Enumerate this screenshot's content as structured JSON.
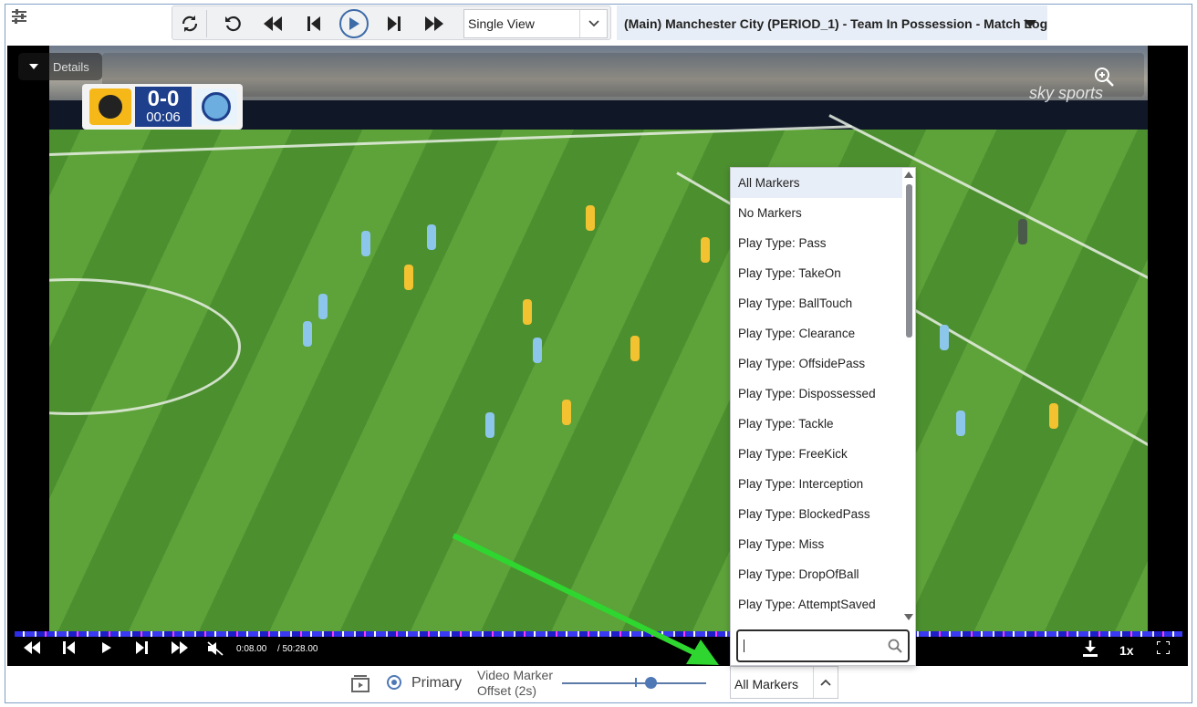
{
  "toolbar": {
    "buttons": [
      "sync",
      "replay",
      "rewind",
      "skip-back",
      "play",
      "skip-forward",
      "fast-forward"
    ],
    "view_select": {
      "value": "Single View"
    },
    "match_log_title": "(Main) Manchester City (PERIOD_1) - Team In Possession - Match Log"
  },
  "video": {
    "details_label": "Details",
    "scoreboard": {
      "score": "0-0",
      "clock": "00:06"
    },
    "broadcaster": "sky sports",
    "controls": {
      "current_time": "0:08.00",
      "total_time": "/ 50:28.00",
      "speed": "1x"
    }
  },
  "bottom": {
    "primary_label": "Primary",
    "offset_label_line1": "Video Marker",
    "offset_label_line2": "Offset (2s)",
    "marker_select_value": "All Markers"
  },
  "dropdown": {
    "items": [
      "All Markers",
      "No Markers",
      "Play Type: Pass",
      "Play Type: TakeOn",
      "Play Type: BallTouch",
      "Play Type: Clearance",
      "Play Type: OffsidePass",
      "Play Type: Dispossessed",
      "Play Type: Tackle",
      "Play Type: FreeKick",
      "Play Type: Interception",
      "Play Type: BlockedPass",
      "Play Type: Miss",
      "Play Type: DropOfBall",
      "Play Type: AttemptSaved"
    ],
    "selected_index": 0,
    "search_value": ""
  },
  "colors": {
    "accent": "#4f78b6",
    "title_bg": "#e8eef7",
    "annotation_arrow": "#2fd62f"
  }
}
